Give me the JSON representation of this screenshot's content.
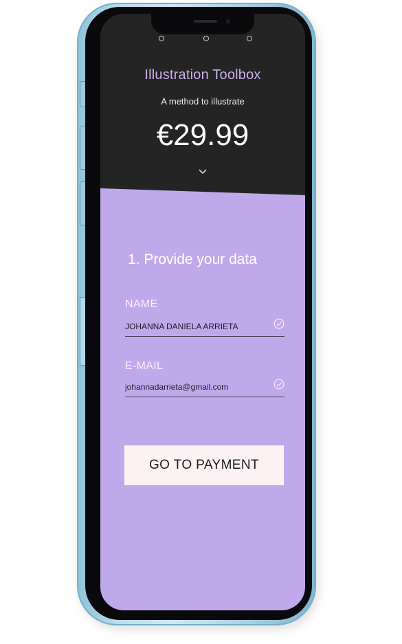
{
  "product": {
    "title": "Illustration Toolbox",
    "subtitle": "A method to illustrate",
    "price": "€29.99"
  },
  "form": {
    "step_title": "1. Provide your data",
    "name": {
      "label": "NAME",
      "value": "JOHANNA DANIELA ARRIETA",
      "validated": true
    },
    "email": {
      "label": "E-MAIL",
      "value": "johannadarrieta@gmail.com",
      "validated": true
    },
    "submit_label": "GO TO PAYMENT"
  },
  "icons": {
    "expand": "chevron-down-icon",
    "valid": "check-circle-icon"
  },
  "colors": {
    "header_bg": "#242424",
    "form_bg": "#c0a9ea",
    "title_accent": "#c7b2ec",
    "button_bg": "#fcf2f3",
    "device_frame": "#a9d2e5"
  }
}
